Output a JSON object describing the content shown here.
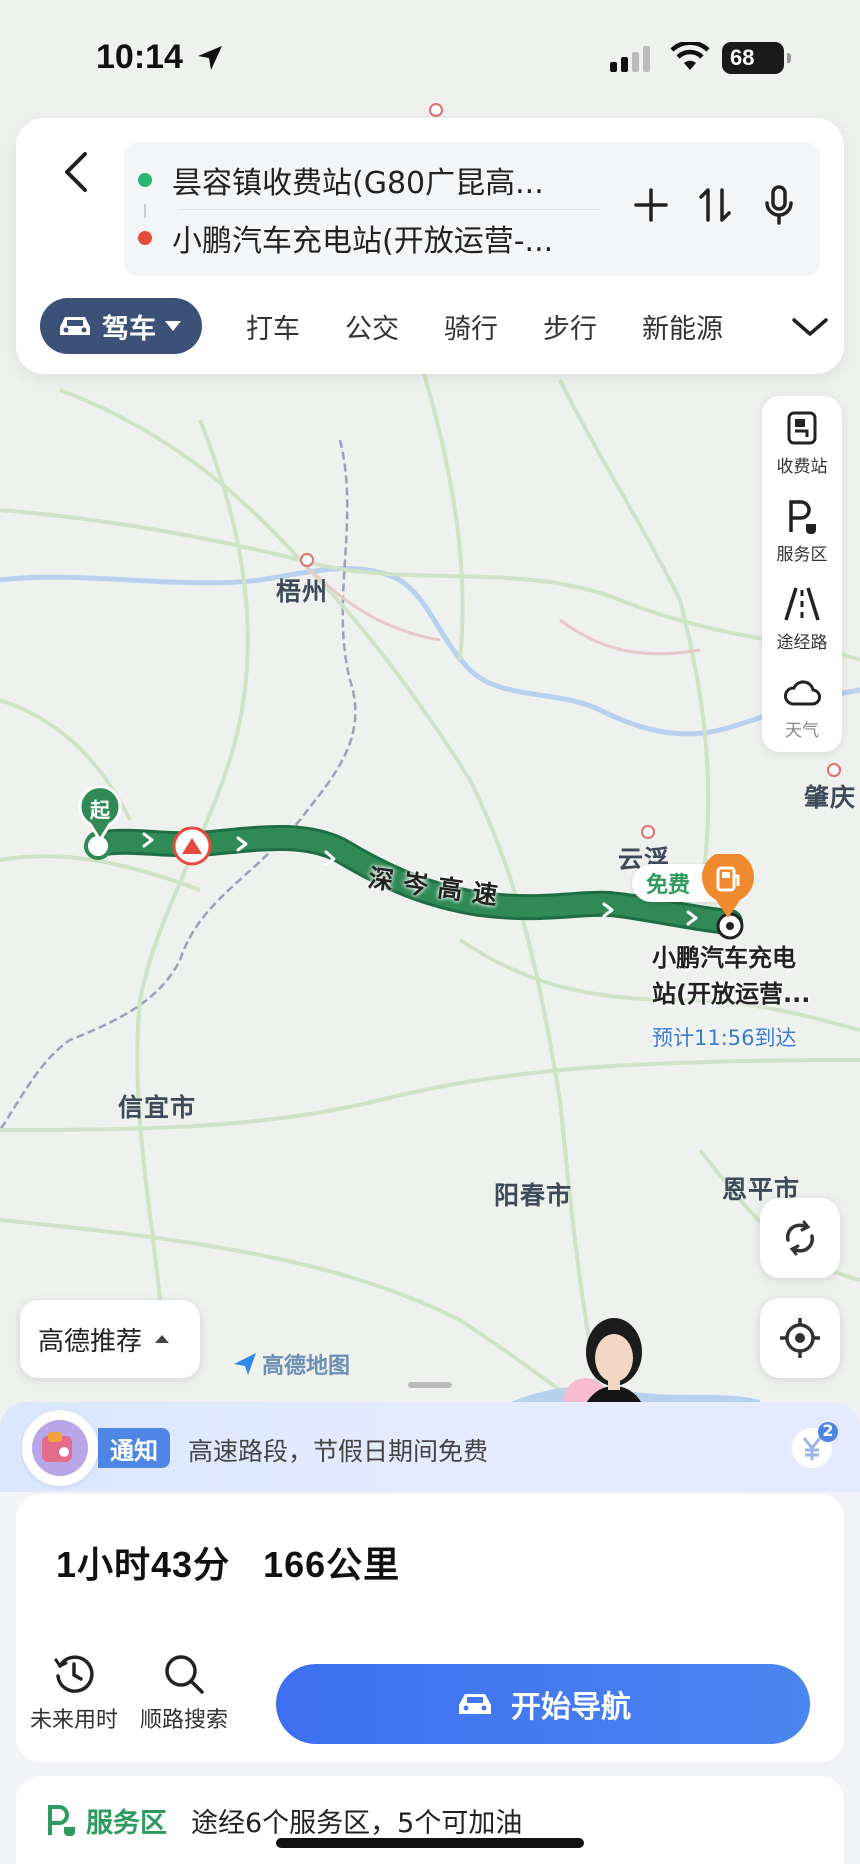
{
  "status_bar": {
    "time": "10:14",
    "battery": "68"
  },
  "route": {
    "origin": "昙容镇收费站(G80广昆高...",
    "destination": "小鹏汽车充电站(开放运营-...",
    "origin_color": "#2bb673",
    "destination_color": "#e54b3c"
  },
  "modes": {
    "active": "驾车",
    "items": [
      "打车",
      "公交",
      "骑行",
      "步行",
      "新能源"
    ]
  },
  "layers": [
    {
      "label": "收费站",
      "icon": "toll-station-icon"
    },
    {
      "label": "服务区",
      "icon": "service-area-icon"
    },
    {
      "label": "途经路",
      "icon": "road-icon"
    },
    {
      "label": "天气",
      "icon": "weather-icon"
    }
  ],
  "map": {
    "cities": {
      "wuzhou": "梧州",
      "zhaoqing": "肇庆",
      "yunfu": "云浮",
      "xinyi": "信宜市",
      "yangchun": "阳春市",
      "enping": "恩平市"
    },
    "start_marker": "起",
    "road_name": "深岑高速",
    "free_tag": "免费",
    "destination_label": "小鹏汽车充电站(开放运营...",
    "eta": "预计11:56到达",
    "recommend": "高德推荐",
    "logo": "高德地图",
    "route_color": "#2f8a55"
  },
  "notice": {
    "tag": "通知",
    "text": "高速路段，节假日期间免费",
    "badge": "2"
  },
  "summary": {
    "duration": "1小时43分",
    "distance": "166公里"
  },
  "actions": {
    "future_time": "未来用时",
    "along_search": "顺路搜索",
    "start_nav": "开始导航"
  },
  "service": {
    "title": "服务区",
    "text": "途经6个服务区，5个可加油"
  }
}
